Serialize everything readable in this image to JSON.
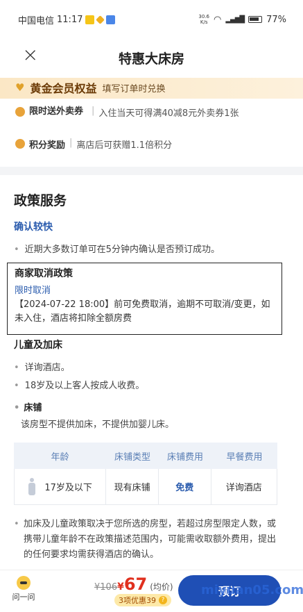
{
  "statusbar": {
    "carrier": "中国电信",
    "time": "11:17",
    "net_speed": "30.6\nK/s",
    "battery": "77%"
  },
  "header": {
    "title": "特惠大床房",
    "close_glyph": "×"
  },
  "benefits": {
    "gold_title": "黄金会员权益",
    "gold_sub": "填写订单时兑换",
    "rows": [
      {
        "label": "限时送外卖券",
        "text": "入住当天可得满40减8元外卖券1张"
      },
      {
        "label": "积分奖励",
        "text": "离店后可获赠1.1倍积分"
      }
    ]
  },
  "policy": {
    "section_title": "政策服务",
    "confirm_title": "确认较快",
    "confirm_text": "近期大多数订单可在5分钟内确认是否预订成功。",
    "cancel": {
      "title": "商家取消政策",
      "subtitle": "限时取消",
      "text": "【2024-07-22 18:00】前可免费取消，逾期不可取消/变更，如未入住，酒店将扣除全额房费"
    },
    "kids": {
      "title": "儿童及加床",
      "bullets": [
        "详询酒店。",
        "18岁及以上客人按成人收费。"
      ],
      "bed_title": "床铺",
      "bed_text": "该房型不提供加床，不提供加婴儿床。"
    },
    "table": {
      "headers": [
        "年龄",
        "床铺类型",
        "床铺费用",
        "早餐费用"
      ],
      "row": [
        "17岁及以下",
        "现有床铺",
        "免费",
        "详询酒店"
      ]
    },
    "note": "加床及儿童政策取决于您所选的房型，若超过房型限定人数，或携带儿童年龄不在政策描述范围内，可能需收取额外费用，提出的任何要求均需获得酒店的确认。"
  },
  "bottom": {
    "ask_label": "问一问",
    "old_price": "¥106",
    "currency": "¥",
    "price": "67",
    "avg_label": "(均价)",
    "promo": "3项优惠39",
    "promo_q": "?",
    "book_label": "预订",
    "watermark": "miyuan05.com"
  },
  "colors": {
    "brand_blue": "#1f4fb5",
    "price_red": "#e0301e",
    "gold": "#6b3a06"
  }
}
